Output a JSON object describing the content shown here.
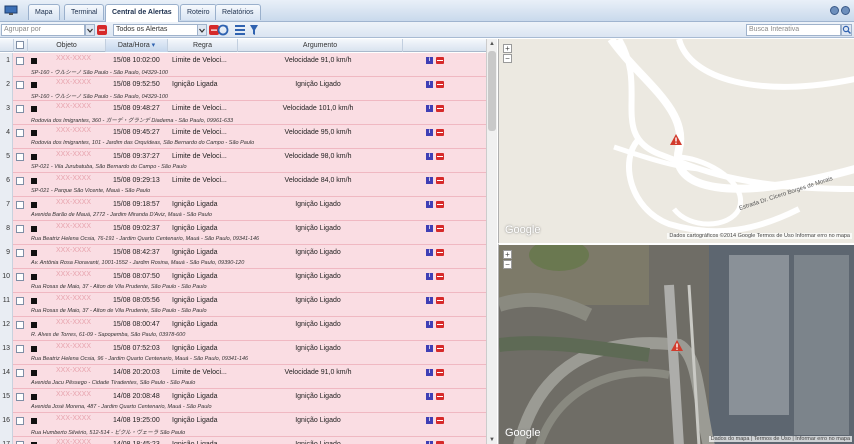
{
  "tabs": [
    {
      "label": "Mapa"
    },
    {
      "label": "Terminal"
    },
    {
      "label": "Central de Alertas"
    },
    {
      "label": "Roteiro"
    },
    {
      "label": "Relatórios"
    }
  ],
  "toolbar": {
    "group_placeholder": "Agrupar por",
    "filter_value": "Todos os Alertas",
    "search_placeholder": "Busca Interativa"
  },
  "columns": {
    "objeto": "Objeto",
    "datahora": "Data/Hora",
    "regra": "Regra",
    "argumento": "Argumento"
  },
  "rows": [
    {
      "n": "1",
      "obj": "XXX-XXXX",
      "dt": "15/08 10:02:00",
      "rule": "Limite de Veloci...",
      "arg": "Velocidade 91,0 km/h",
      "addr": "SP-160 - ウルシーノ São Paulo - São Paulo, 04329-100"
    },
    {
      "n": "2",
      "obj": "XXX-XXXX",
      "dt": "15/08 09:52:50",
      "rule": "Ignição Ligada",
      "arg": "Ignição Ligado",
      "addr": "SP-160 - ウルシーノ São Paulo - São Paulo, 04329-100"
    },
    {
      "n": "3",
      "obj": "XXX-XXXX",
      "dt": "15/08 09:48:27",
      "rule": "Limite de Veloci...",
      "arg": "Velocidade 101,0 km/h",
      "addr": "Rodovia dos Imigrantes, 360 - ガーデ・グランデ Diadema - São Paulo, 09961-633"
    },
    {
      "n": "4",
      "obj": "XXX-XXXX",
      "dt": "15/08 09:45:27",
      "rule": "Limite de Veloci...",
      "arg": "Velocidade 95,0 km/h",
      "addr": "Rodovia dos Imigrantes, 101 - Jardim das Orquídeas, São Bernardo do Campo - São Paulo"
    },
    {
      "n": "5",
      "obj": "XXX-XXXX",
      "dt": "15/08 09:37:27",
      "rule": "Limite de Veloci...",
      "arg": "Velocidade 98,0 km/h",
      "addr": "SP-021 - Vila Jurubatuba, São Bernardo do Campo - São Paulo"
    },
    {
      "n": "6",
      "obj": "XXX-XXXX",
      "dt": "15/08 09:29:13",
      "rule": "Limite de Veloci...",
      "arg": "Velocidade 84,0 km/h",
      "addr": "SP-021 - Parque São Vicente, Mauá - São Paulo"
    },
    {
      "n": "7",
      "obj": "XXX-XXXX",
      "dt": "15/08 09:18:57",
      "rule": "Ignição Ligada",
      "arg": "Ignição Ligado",
      "addr": "Avenida Barão de Mauá, 2772 - Jardim Miranda D'Aviz, Mauá - São Paulo"
    },
    {
      "n": "8",
      "obj": "XXX-XXXX",
      "dt": "15/08 09:02:37",
      "rule": "Ignição Ligada",
      "arg": "Ignição Ligado",
      "addr": "Rua Beatriz Helena Ocsia, 76-191 - Jardim Quarto Centenario, Mauá - São Paulo, 09341-146"
    },
    {
      "n": "9",
      "obj": "XXX-XXXX",
      "dt": "15/08 08:42:37",
      "rule": "Ignição Ligada",
      "arg": "Ignição Ligado",
      "addr": "Av. Antônia Rosa Fioravanti, 1001-1552 - Jardim Rosina, Mauá - São Paulo, 09390-120"
    },
    {
      "n": "10",
      "obj": "XXX-XXXX",
      "dt": "15/08 08:07:50",
      "rule": "Ignição Ligada",
      "arg": "Ignição Ligado",
      "addr": "Rua Rosas de Maio, 37 - Alton de Vila Prudente, São Paulo - São Paulo"
    },
    {
      "n": "11",
      "obj": "XXX-XXXX",
      "dt": "15/08 08:05:56",
      "rule": "Ignição Ligada",
      "arg": "Ignição Ligado",
      "addr": "Rua Rosas de Maio, 37 - Alton de Vila Prudente, São Paulo - São Paulo"
    },
    {
      "n": "12",
      "obj": "XXX-XXXX",
      "dt": "15/08 08:00:47",
      "rule": "Ignição Ligada",
      "arg": "Ignição Ligado",
      "addr": "R. Alves de Torres, 61-09 - Sapopemba, São Paulo, 03978-600"
    },
    {
      "n": "13",
      "obj": "XXX-XXXX",
      "dt": "15/08 07:52:03",
      "rule": "Ignição Ligada",
      "arg": "Ignição Ligado",
      "addr": "Rua Beatriz Helena Ocsia, 96 - Jardim Quarto Centenario, Mauá - São Paulo, 09341-146"
    },
    {
      "n": "14",
      "obj": "XXX-XXXX",
      "dt": "14/08 20:20:03",
      "rule": "Limite de Veloci...",
      "arg": "Velocidade 91,0 km/h",
      "addr": "Avenida Jacu Pêssego - Cidade Tiradentes, São Paulo - São Paulo"
    },
    {
      "n": "15",
      "obj": "XXX-XXXX",
      "dt": "14/08 20:08:48",
      "rule": "Ignição Ligada",
      "arg": "Ignição Ligado",
      "addr": "Avenida José Morena, 487 - Jardim Quarto Centenario, Mauá - São Paulo"
    },
    {
      "n": "16",
      "obj": "XXX-XXXX",
      "dt": "14/08 19:25:00",
      "rule": "Ignição Ligada",
      "arg": "Ignição Ligado",
      "addr": "Rua Humberto Silvério, 512-514 - ビクル・ヴェーラ São Paulo"
    },
    {
      "n": "17",
      "obj": "XXX-XXXX",
      "dt": "14/08 18:45:23",
      "rule": "Ignição Ligada",
      "arg": "Ignição Ligado",
      "addr": ""
    }
  ],
  "map_top": {
    "google": "Google",
    "credit": "Dados cartográficos ©2014 Google   Termos de Uso   Informar erro no mapa",
    "road_label": "Estrada Dr. Cícero Borges de Morais",
    "zoom_in": "+",
    "zoom_out": "−"
  },
  "map_bottom": {
    "google": "Google",
    "credit": "Dados do mapa  |  Termos de Uso  |  Informar erro no mapa",
    "zoom_in": "+",
    "zoom_out": "−"
  },
  "icons": {
    "app": "monitor-icon",
    "refresh": "refresh-icon",
    "filter": "funnel-icon",
    "group": "group-icon",
    "search": "magnifier-icon",
    "warning": "warning-icon"
  },
  "colors": {
    "alert_row": "#fadde3",
    "header": "#d9e3ef",
    "accent": "#3f3fb5",
    "warning": "#d62a2a"
  }
}
